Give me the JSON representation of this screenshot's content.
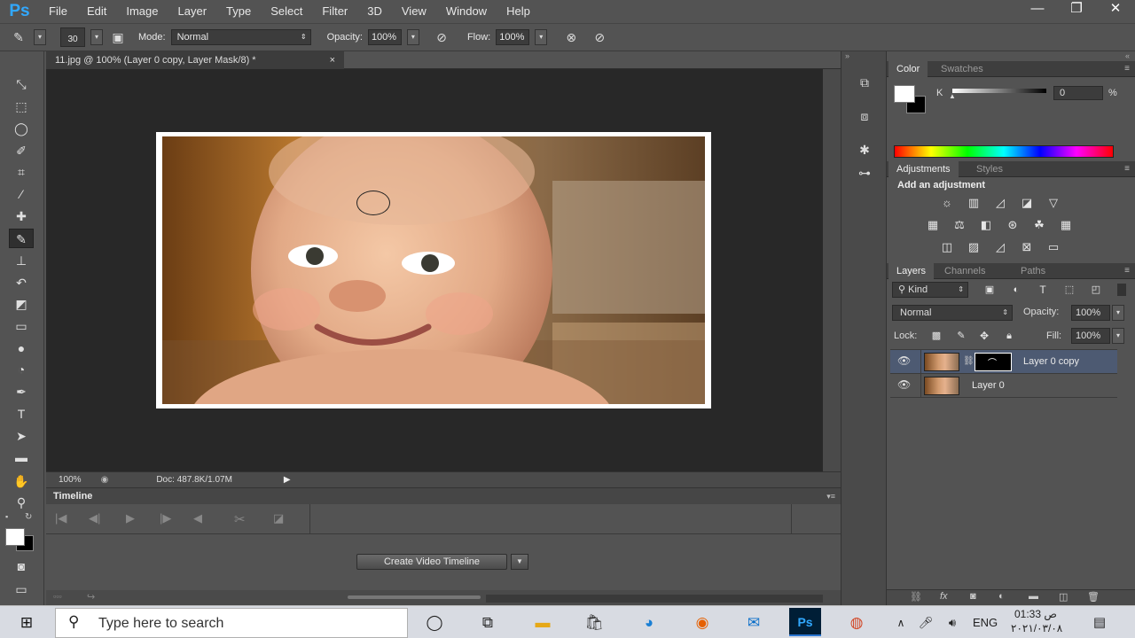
{
  "app": {
    "logo": "Ps",
    "accent": "#31a8ff"
  },
  "menu": [
    "File",
    "Edit",
    "Image",
    "Layer",
    "Type",
    "Select",
    "Filter",
    "3D",
    "View",
    "Window",
    "Help"
  ],
  "window_controls": {
    "minimize": "—",
    "restore": "❐",
    "close": "✕"
  },
  "options": {
    "brush_size": "30",
    "mode_label": "Mode:",
    "mode_value": "Normal",
    "opacity_label": "Opacity:",
    "opacity_value": "100%",
    "flow_label": "Flow:",
    "flow_value": "100%"
  },
  "document": {
    "tab_title": "11.jpg @ 100% (Layer 0 copy, Layer Mask/8) *",
    "close_glyph": "×"
  },
  "status": {
    "zoom": "100%",
    "doc_size": "Doc: 487.8K/1.07M"
  },
  "timeline": {
    "title": "Timeline",
    "create_label": "Create Video Timeline"
  },
  "color_panel": {
    "tabs": [
      "Color",
      "Swatches"
    ],
    "channel_label": "K",
    "channel_value": "0",
    "unit": "%",
    "foreground": "#ffffff",
    "background": "#000000"
  },
  "adjustments_panel": {
    "tabs": [
      "Adjustments",
      "Styles"
    ],
    "heading": "Add an adjustment"
  },
  "layers_panel": {
    "tabs": [
      "Layers",
      "Channels",
      "Paths"
    ],
    "filter_label": "Kind",
    "blend_mode": "Normal",
    "opacity_label": "Opacity:",
    "opacity_value": "100%",
    "lock_label": "Lock:",
    "fill_label": "Fill:",
    "fill_value": "100%",
    "layers": [
      {
        "name": "Layer 0 copy",
        "has_mask": true,
        "selected": true
      },
      {
        "name": "Layer 0",
        "has_mask": false,
        "selected": false
      }
    ],
    "selected_color": "#4d5a72"
  },
  "taskbar": {
    "search_placeholder": "Type here to search",
    "lang": "ENG",
    "time": "01:33 ص",
    "date": "٢٠٢١/٠٣/٠٨"
  }
}
